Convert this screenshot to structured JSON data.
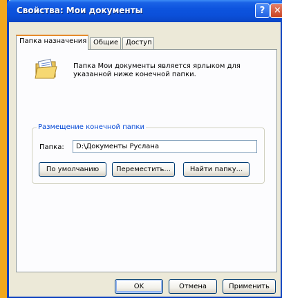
{
  "window": {
    "title": "Свойства: Мои документы"
  },
  "titlebar_buttons": {
    "help": "?",
    "close": "✕"
  },
  "tabs": [
    {
      "label": "Папка назначения",
      "active": true
    },
    {
      "label": "Общие",
      "active": false
    },
    {
      "label": "Доступ",
      "active": false
    }
  ],
  "description": "Папка Мои документы является ярлыком для указанной ниже конечной папки.",
  "target_group": {
    "legend": "Размещение конечной папки",
    "path_label": "Папка:",
    "path_value": "D:\\Документы Руслана",
    "buttons": {
      "default": "По умолчанию",
      "move": "Переместить...",
      "find": "Найти папку..."
    }
  },
  "footer": {
    "ok": "OK",
    "cancel": "Отмена",
    "apply": "Применить"
  },
  "colors": {
    "titlebar": "#0b4fd9",
    "accent_tab": "#e68b2c",
    "legend": "#0046d5",
    "desktop": "#f2a81d"
  }
}
